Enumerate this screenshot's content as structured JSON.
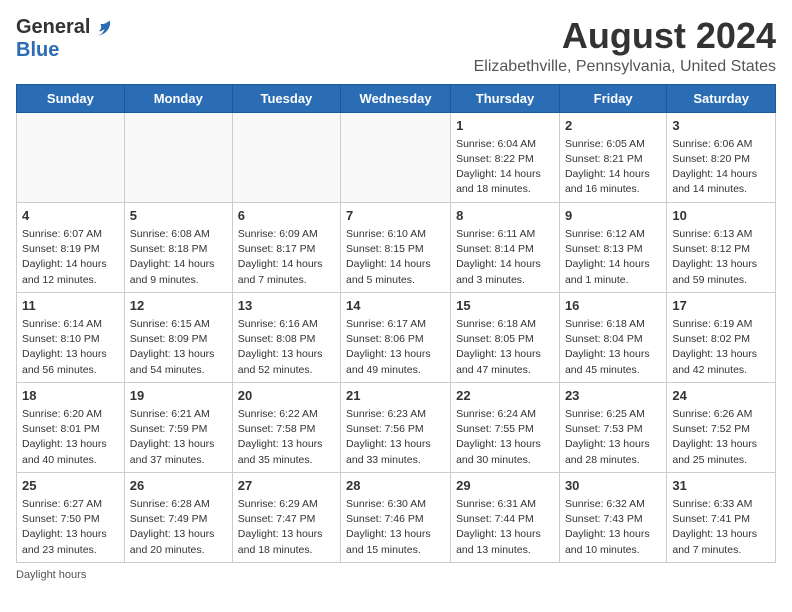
{
  "logo": {
    "general": "General",
    "blue": "Blue"
  },
  "title": "August 2024",
  "subtitle": "Elizabethville, Pennsylvania, United States",
  "footer": "Daylight hours",
  "headers": [
    "Sunday",
    "Monday",
    "Tuesday",
    "Wednesday",
    "Thursday",
    "Friday",
    "Saturday"
  ],
  "weeks": [
    [
      {
        "day": "",
        "info": ""
      },
      {
        "day": "",
        "info": ""
      },
      {
        "day": "",
        "info": ""
      },
      {
        "day": "",
        "info": ""
      },
      {
        "day": "1",
        "info": "Sunrise: 6:04 AM\nSunset: 8:22 PM\nDaylight: 14 hours\nand 18 minutes."
      },
      {
        "day": "2",
        "info": "Sunrise: 6:05 AM\nSunset: 8:21 PM\nDaylight: 14 hours\nand 16 minutes."
      },
      {
        "day": "3",
        "info": "Sunrise: 6:06 AM\nSunset: 8:20 PM\nDaylight: 14 hours\nand 14 minutes."
      }
    ],
    [
      {
        "day": "4",
        "info": "Sunrise: 6:07 AM\nSunset: 8:19 PM\nDaylight: 14 hours\nand 12 minutes."
      },
      {
        "day": "5",
        "info": "Sunrise: 6:08 AM\nSunset: 8:18 PM\nDaylight: 14 hours\nand 9 minutes."
      },
      {
        "day": "6",
        "info": "Sunrise: 6:09 AM\nSunset: 8:17 PM\nDaylight: 14 hours\nand 7 minutes."
      },
      {
        "day": "7",
        "info": "Sunrise: 6:10 AM\nSunset: 8:15 PM\nDaylight: 14 hours\nand 5 minutes."
      },
      {
        "day": "8",
        "info": "Sunrise: 6:11 AM\nSunset: 8:14 PM\nDaylight: 14 hours\nand 3 minutes."
      },
      {
        "day": "9",
        "info": "Sunrise: 6:12 AM\nSunset: 8:13 PM\nDaylight: 14 hours\nand 1 minute."
      },
      {
        "day": "10",
        "info": "Sunrise: 6:13 AM\nSunset: 8:12 PM\nDaylight: 13 hours\nand 59 minutes."
      }
    ],
    [
      {
        "day": "11",
        "info": "Sunrise: 6:14 AM\nSunset: 8:10 PM\nDaylight: 13 hours\nand 56 minutes."
      },
      {
        "day": "12",
        "info": "Sunrise: 6:15 AM\nSunset: 8:09 PM\nDaylight: 13 hours\nand 54 minutes."
      },
      {
        "day": "13",
        "info": "Sunrise: 6:16 AM\nSunset: 8:08 PM\nDaylight: 13 hours\nand 52 minutes."
      },
      {
        "day": "14",
        "info": "Sunrise: 6:17 AM\nSunset: 8:06 PM\nDaylight: 13 hours\nand 49 minutes."
      },
      {
        "day": "15",
        "info": "Sunrise: 6:18 AM\nSunset: 8:05 PM\nDaylight: 13 hours\nand 47 minutes."
      },
      {
        "day": "16",
        "info": "Sunrise: 6:18 AM\nSunset: 8:04 PM\nDaylight: 13 hours\nand 45 minutes."
      },
      {
        "day": "17",
        "info": "Sunrise: 6:19 AM\nSunset: 8:02 PM\nDaylight: 13 hours\nand 42 minutes."
      }
    ],
    [
      {
        "day": "18",
        "info": "Sunrise: 6:20 AM\nSunset: 8:01 PM\nDaylight: 13 hours\nand 40 minutes."
      },
      {
        "day": "19",
        "info": "Sunrise: 6:21 AM\nSunset: 7:59 PM\nDaylight: 13 hours\nand 37 minutes."
      },
      {
        "day": "20",
        "info": "Sunrise: 6:22 AM\nSunset: 7:58 PM\nDaylight: 13 hours\nand 35 minutes."
      },
      {
        "day": "21",
        "info": "Sunrise: 6:23 AM\nSunset: 7:56 PM\nDaylight: 13 hours\nand 33 minutes."
      },
      {
        "day": "22",
        "info": "Sunrise: 6:24 AM\nSunset: 7:55 PM\nDaylight: 13 hours\nand 30 minutes."
      },
      {
        "day": "23",
        "info": "Sunrise: 6:25 AM\nSunset: 7:53 PM\nDaylight: 13 hours\nand 28 minutes."
      },
      {
        "day": "24",
        "info": "Sunrise: 6:26 AM\nSunset: 7:52 PM\nDaylight: 13 hours\nand 25 minutes."
      }
    ],
    [
      {
        "day": "25",
        "info": "Sunrise: 6:27 AM\nSunset: 7:50 PM\nDaylight: 13 hours\nand 23 minutes."
      },
      {
        "day": "26",
        "info": "Sunrise: 6:28 AM\nSunset: 7:49 PM\nDaylight: 13 hours\nand 20 minutes."
      },
      {
        "day": "27",
        "info": "Sunrise: 6:29 AM\nSunset: 7:47 PM\nDaylight: 13 hours\nand 18 minutes."
      },
      {
        "day": "28",
        "info": "Sunrise: 6:30 AM\nSunset: 7:46 PM\nDaylight: 13 hours\nand 15 minutes."
      },
      {
        "day": "29",
        "info": "Sunrise: 6:31 AM\nSunset: 7:44 PM\nDaylight: 13 hours\nand 13 minutes."
      },
      {
        "day": "30",
        "info": "Sunrise: 6:32 AM\nSunset: 7:43 PM\nDaylight: 13 hours\nand 10 minutes."
      },
      {
        "day": "31",
        "info": "Sunrise: 6:33 AM\nSunset: 7:41 PM\nDaylight: 13 hours\nand 7 minutes."
      }
    ]
  ]
}
